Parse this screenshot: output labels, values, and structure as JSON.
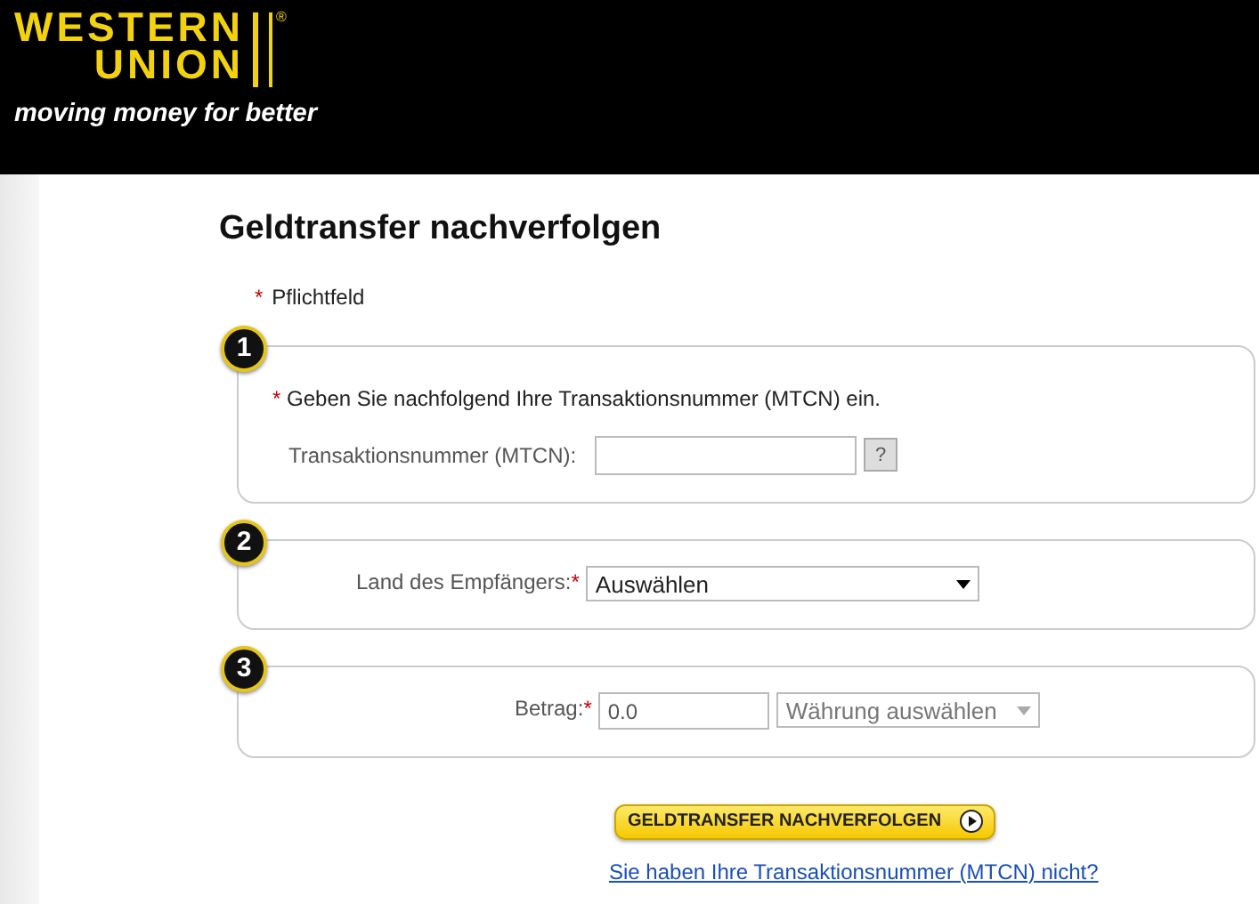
{
  "logo": {
    "line_1": "WESTERN",
    "line_2": "UNION",
    "registered_mark": "®",
    "tagline": "moving money for better"
  },
  "page_title": "Geldtransfer nachverfolgen",
  "required_note": {
    "marker": "*",
    "text": "Pflichtfeld"
  },
  "steps": [
    {
      "number": "1",
      "kind": "mtcn",
      "instruction_marker": "*",
      "instruction": "Geben Sie nachfolgend Ihre Transaktionsnummer (MTCN) ein.",
      "label": "Transaktionsnummer (MTCN):",
      "help": "?"
    },
    {
      "number": "2",
      "kind": "country",
      "label": "Land des Empfängers:",
      "marker": "*",
      "value": "Auswählen"
    },
    {
      "number": "3",
      "kind": "amount",
      "label": "Betrag:",
      "marker": "*",
      "amount": "0.0",
      "currency": {
        "value": "Währung auswählen",
        "disabled": true
      }
    }
  ],
  "submit_button": "GELDTRANSFER NACHVERFOLGEN",
  "help_link": "Sie haben Ihre Transaktionsnummer (MTCN) nicht?"
}
